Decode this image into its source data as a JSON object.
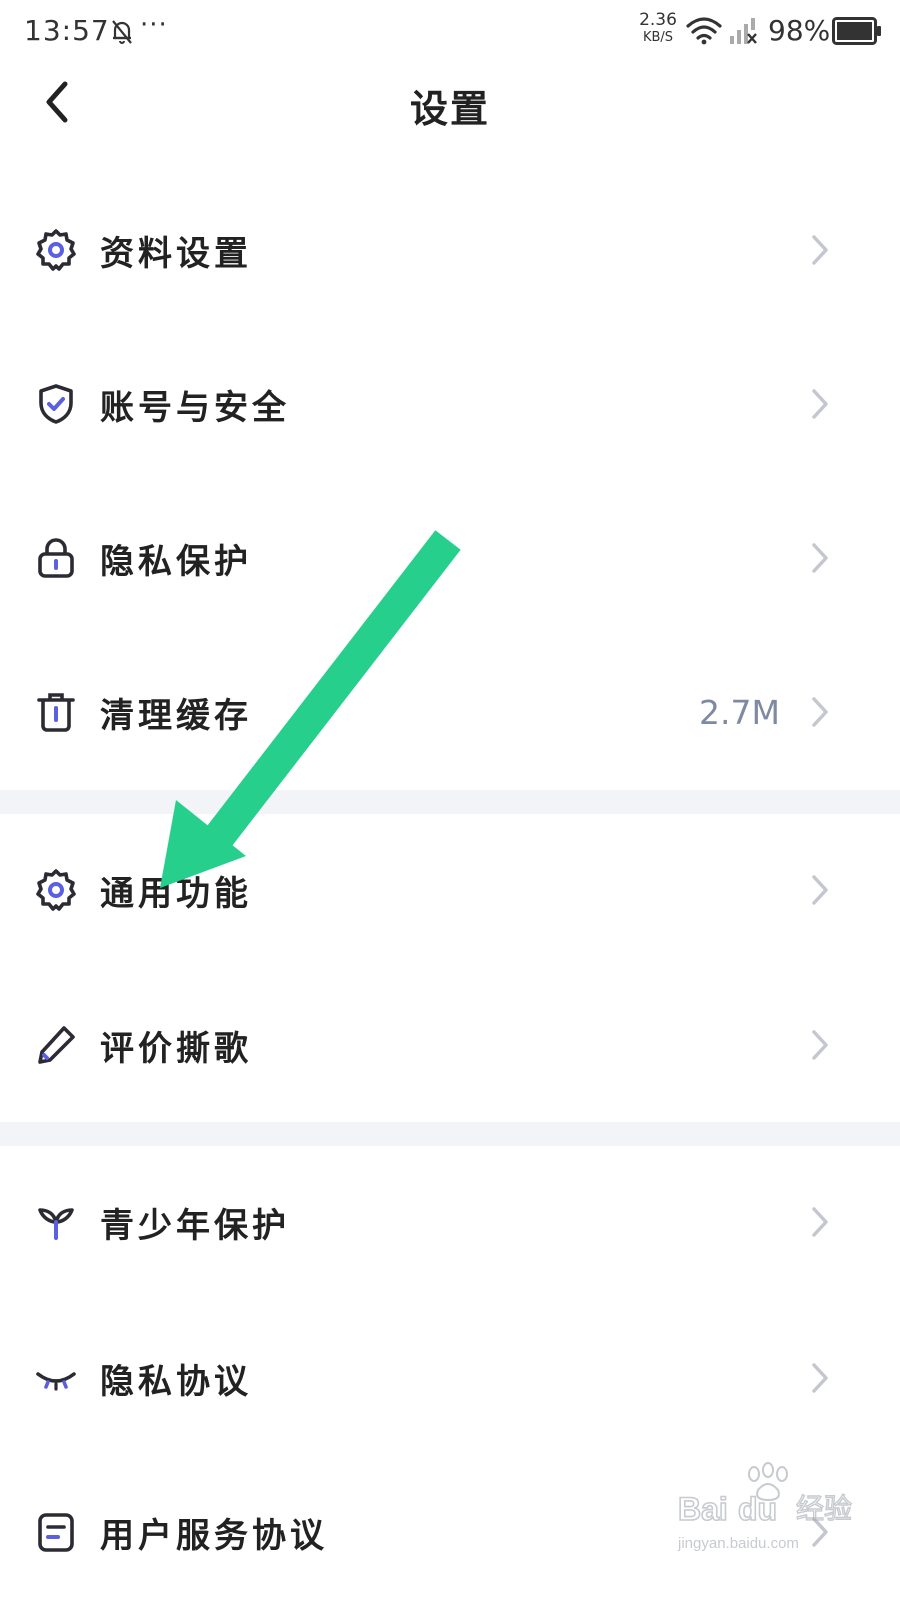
{
  "status_bar": {
    "time": "13:57",
    "notif_icon": "bell-off-icon",
    "more": "···",
    "speed_value": "2.36",
    "speed_unit": "KB/S",
    "battery": "98%"
  },
  "header": {
    "title": "设置",
    "back_icon": "chevron-left-icon"
  },
  "settings": {
    "items": [
      {
        "label": "资料设置",
        "icon": "gear-icon",
        "value": ""
      },
      {
        "label": "账号与安全",
        "icon": "shield-check-icon",
        "value": ""
      },
      {
        "label": "隐私保护",
        "icon": "lock-icon",
        "value": ""
      },
      {
        "label": "清理缓存",
        "icon": "trash-icon",
        "value": "2.7M"
      },
      {
        "label": "通用功能",
        "icon": "gear-icon",
        "value": ""
      },
      {
        "label": "评价撕歌",
        "icon": "pen-icon",
        "value": ""
      },
      {
        "label": "青少年保护",
        "icon": "sprout-icon",
        "value": ""
      },
      {
        "label": "隐私协议",
        "icon": "closed-eye-icon",
        "value": ""
      },
      {
        "label": "用户服务协议",
        "icon": "document-icon",
        "value": ""
      }
    ]
  },
  "colors": {
    "accent": "#5b5fe0",
    "icon_stroke": "#2b2b33",
    "divider": "#f3f4f8",
    "value_text": "#7e8aa3",
    "chevron": "#c4c7cf",
    "annotation_arrow": "#27cf8c"
  },
  "watermark": {
    "brand": "Bai",
    "brand2": "du",
    "cn": "经验",
    "url": "jingyan.baidu.com"
  }
}
